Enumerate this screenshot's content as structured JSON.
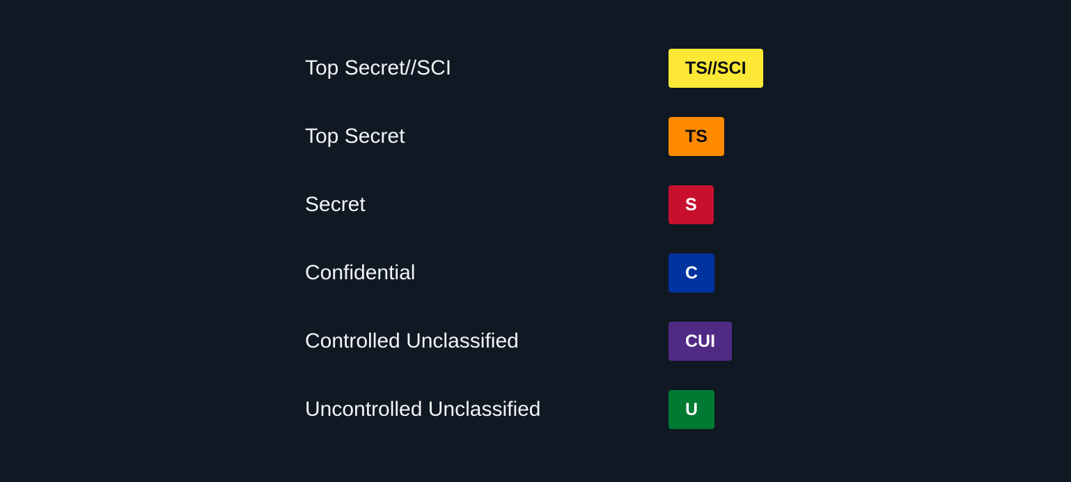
{
  "legend": {
    "items": [
      {
        "label": "Top Secret//SCI",
        "badge": "TS//SCI",
        "bg": "#FDE835",
        "fg": "#0b0f14"
      },
      {
        "label": "Top Secret",
        "badge": "TS",
        "bg": "#FF8A00",
        "fg": "#0b0f14"
      },
      {
        "label": "Secret",
        "badge": "S",
        "bg": "#C8102E",
        "fg": "#ffffff"
      },
      {
        "label": "Confidential",
        "badge": "C",
        "bg": "#0033A0",
        "fg": "#ffffff"
      },
      {
        "label": "Controlled Unclassified",
        "badge": "CUI",
        "bg": "#502B85",
        "fg": "#ffffff"
      },
      {
        "label": "Uncontrolled Unclassified",
        "badge": "U",
        "bg": "#007A33",
        "fg": "#ffffff"
      }
    ]
  }
}
